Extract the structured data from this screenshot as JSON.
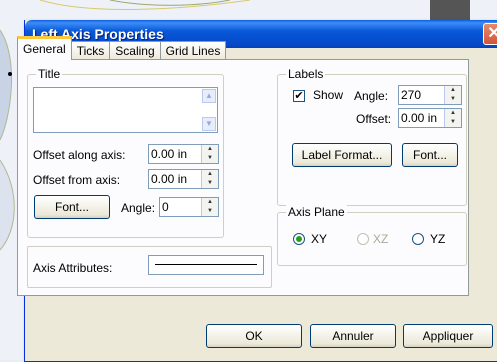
{
  "dialog": {
    "title": "Left Axis Properties"
  },
  "tabs": [
    "General",
    "Ticks",
    "Scaling",
    "Grid Lines"
  ],
  "title_group": {
    "label": "Title",
    "offset_along_label": "Offset along axis:",
    "offset_along_value": "0.00 in",
    "offset_from_label": "Offset from axis:",
    "offset_from_value": "0.00 in",
    "font_button": "Font...",
    "angle_label": "Angle:",
    "angle_value": "0"
  },
  "axis_attributes": {
    "label": "Axis Attributes:"
  },
  "labels_group": {
    "label": "Labels",
    "show_label": "Show",
    "show_checked": true,
    "angle_label": "Angle:",
    "angle_value": "270",
    "offset_label": "Offset:",
    "offset_value": "0.00 in",
    "label_format_button": "Label Format...",
    "font_button": "Font..."
  },
  "axis_plane_group": {
    "label": "Axis Plane",
    "options": [
      "XY",
      "XZ",
      "YZ"
    ],
    "selected": "XY"
  },
  "footer": {
    "ok": "OK",
    "cancel": "Annuler",
    "apply": "Appliquer"
  },
  "colors": {
    "title_bar": "#0758d8",
    "dialog_bg": "#ece9d8",
    "close": "#d4533a"
  }
}
